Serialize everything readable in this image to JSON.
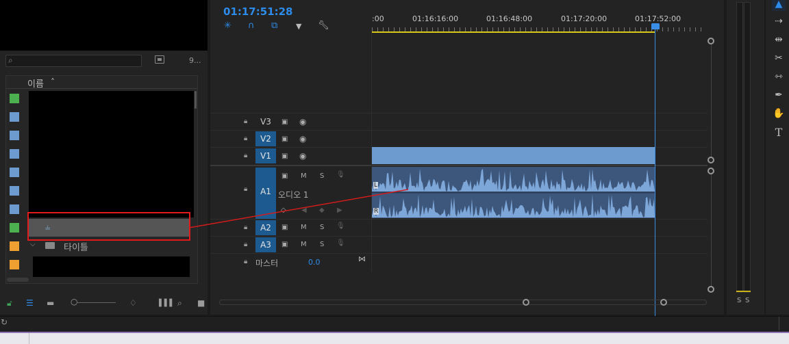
{
  "project": {
    "search_placeholder": "",
    "item_count": "9...",
    "column_name": "이름",
    "sort_indicator": "^",
    "folder_label": "타이틀",
    "swatch_colors": [
      "#4caf50",
      "#6d9bd0",
      "#6d9bd0",
      "#6d9bd0",
      "#6d9bd0",
      "#6d9bd0",
      "#6d9bd0",
      "#4caf50",
      "#f0a030",
      "#f0a030"
    ],
    "bottom_icons": [
      "lock-icon",
      "list-view-icon",
      "icon-view-icon",
      "zoom-slider",
      "sort-icon",
      "automate-icon",
      "find-icon",
      "new-bin-icon"
    ]
  },
  "timeline": {
    "timecode": "01:17:51:28",
    "ruler_labels": [
      ":00",
      "01:16:16:00",
      "01:16:48:00",
      "01:17:20:00",
      "01:17:52:00"
    ],
    "tracks": {
      "v3": "V3",
      "v2": "V2",
      "v1": "V1",
      "a1": "A1",
      "a1_name": "오디오 1",
      "a2": "A2",
      "a3": "A3",
      "master": "마스터",
      "master_value": "0.0",
      "mute": "M",
      "solo": "S"
    },
    "channel_left": "L",
    "channel_right": "R"
  },
  "meter": {
    "solo_left": "S",
    "solo_right": "S"
  },
  "tools": [
    "selection-tool",
    "track-select-tool",
    "ripple-edit-tool",
    "razor-tool",
    "slip-tool",
    "pen-tool",
    "hand-tool",
    "type-tool"
  ],
  "colors": {
    "accent": "#2d8ceb",
    "highlight_box": "#e11b1b",
    "clip_video": "#6d9bd0",
    "clip_audio": "#3d577c",
    "track_target": "#1d5a8f",
    "work_area": "#d7c81a"
  }
}
